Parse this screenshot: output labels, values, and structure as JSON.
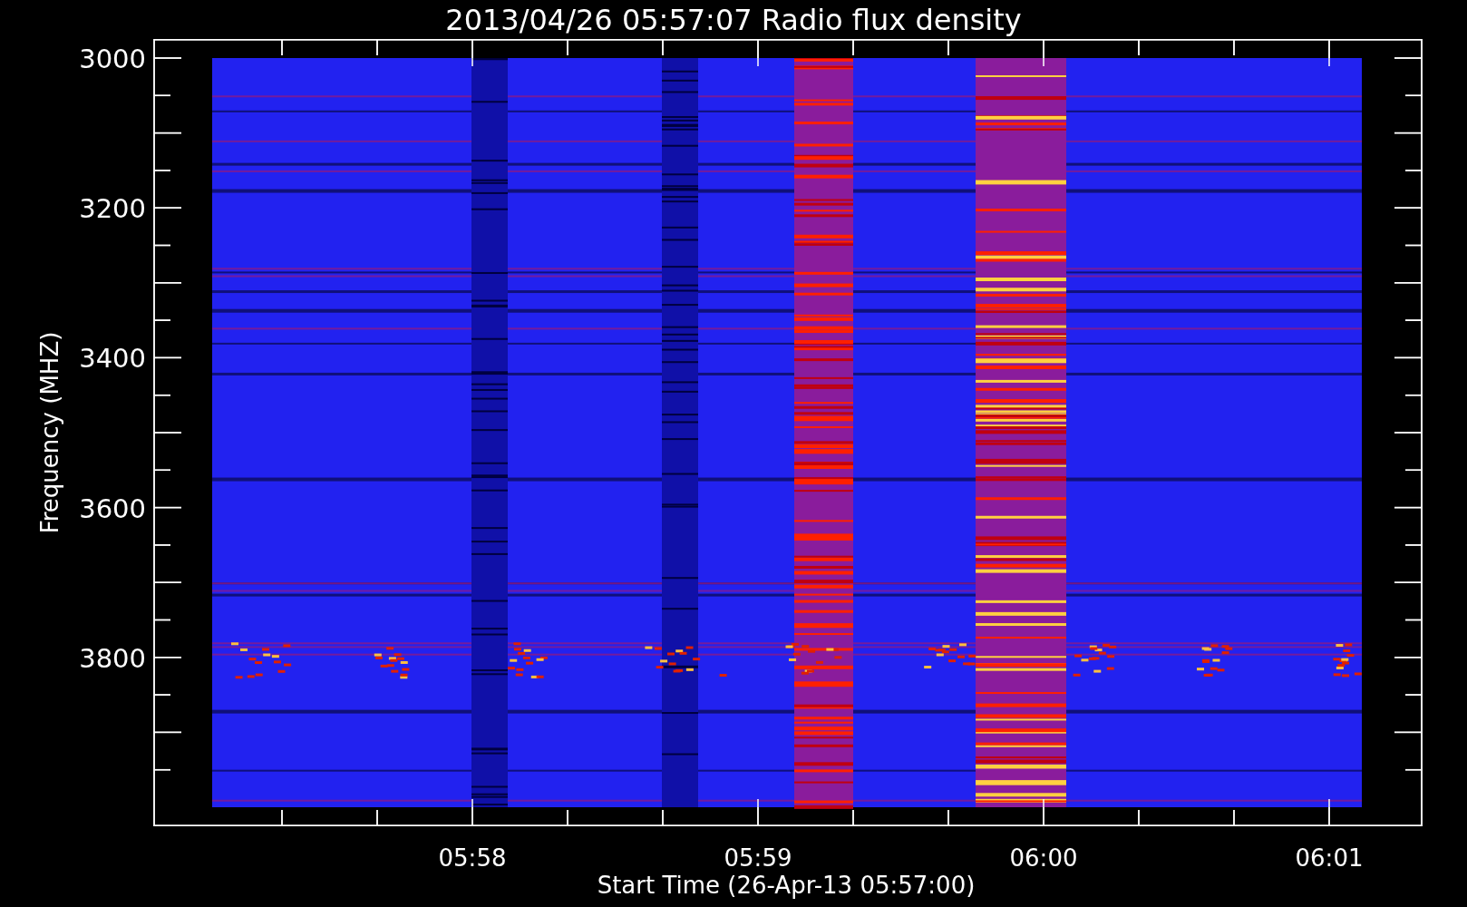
{
  "title": "2013/04/26 05:57:07 Radio flux density",
  "y_axis": {
    "title": "Frequency (MHZ)",
    "ticks": [
      "3000",
      "3200",
      "3400",
      "3600",
      "3800"
    ]
  },
  "x_axis": {
    "title": "Start Time (26-Apr-13 05:57:00)",
    "ticks": [
      "05:58",
      "05:59",
      "06:00",
      "06:01"
    ]
  }
}
